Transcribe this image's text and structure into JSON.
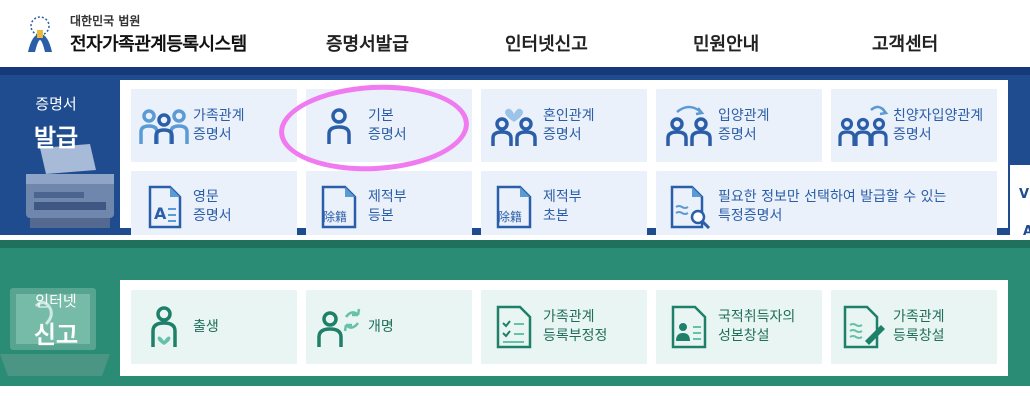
{
  "header": {
    "org": "대한민국 법원",
    "system": "전자가족관계등록시스템",
    "logo_icon": "court-emblem-icon",
    "nav": [
      "증명서발급",
      "인터넷신고",
      "민원안내",
      "고객센터"
    ]
  },
  "issue_section": {
    "label_small": "증명서",
    "label_big": "발급",
    "tiles": [
      {
        "icon": "family-group-icon",
        "line1": "가족관계",
        "line2": "증명서"
      },
      {
        "icon": "person-icon",
        "line1": "기본",
        "line2": "증명서"
      },
      {
        "icon": "couple-heart-icon",
        "line1": "혼인관계",
        "line2": "증명서"
      },
      {
        "icon": "adoption-arrows-icon",
        "line1": "입양관계",
        "line2": "증명서"
      },
      {
        "icon": "family-adoption-icon",
        "line1": "친양자입양관계",
        "line2": "증명서"
      },
      {
        "icon": "english-document-icon",
        "line1": "영문",
        "line2": "증명서"
      },
      {
        "icon": "removed-register-document-icon",
        "line1": "제적부",
        "line2": "등본",
        "badge": "除籍"
      },
      {
        "icon": "removed-register-document-icon",
        "line1": "제적부",
        "line2": "초본",
        "badge": "除籍"
      },
      {
        "icon": "document-search-icon",
        "line1": "필요한 정보만 선택하여 발급할 수 있는",
        "line2": "특정증명서"
      }
    ],
    "side_chars": [
      "V",
      "A"
    ]
  },
  "report_section": {
    "label_small": "인터넷",
    "label_big": "신고",
    "tiles": [
      {
        "icon": "birth-icon",
        "line1": "출생",
        "line2": ""
      },
      {
        "icon": "rename-icon",
        "line1": "개명",
        "line2": ""
      },
      {
        "icon": "checklist-document-icon",
        "line1": "가족관계",
        "line2": "등록부정정"
      },
      {
        "icon": "id-card-document-icon",
        "line1": "국적취득자의",
        "line2": "성본창설"
      },
      {
        "icon": "document-pen-icon",
        "line1": "가족관계",
        "line2": "등록창설"
      }
    ]
  },
  "colors": {
    "blue_band": "#1e4c8f",
    "green_band": "#2a8c74",
    "annotation": "#f07af0"
  }
}
